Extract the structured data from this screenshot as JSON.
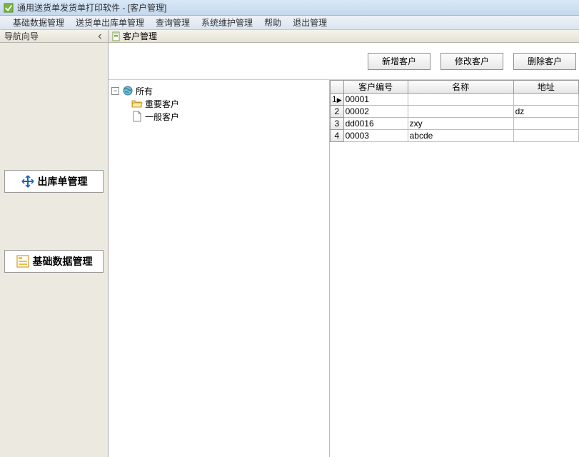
{
  "window": {
    "title": "通用送货单发货单打印软件  - [客户管理]"
  },
  "menubar": {
    "items": [
      "基础数据管理",
      "送货单出库单管理",
      "查询管理",
      "系统维护管理",
      "帮助",
      "退出管理"
    ]
  },
  "nav": {
    "header": "导航向导",
    "buttons": {
      "outbound": "出库单管理",
      "basedata": "基础数据管理"
    }
  },
  "content": {
    "tab_title": "客户管理"
  },
  "toolbar": {
    "add": "新增客户",
    "edit": "修改客户",
    "delete": "删除客户"
  },
  "tree": {
    "root": "所有",
    "children": [
      {
        "label": "重要客户",
        "icon": "folder"
      },
      {
        "label": "一般客户",
        "icon": "doc"
      }
    ]
  },
  "grid": {
    "headers": {
      "code": "客户编号",
      "name": "名称",
      "address": "地址"
    },
    "rows": [
      {
        "n": "1",
        "code": "00001",
        "name": "",
        "address": ""
      },
      {
        "n": "2",
        "code": "00002",
        "name": "",
        "address": "dz"
      },
      {
        "n": "3",
        "code": "dd0016",
        "name": "zxy",
        "address": ""
      },
      {
        "n": "4",
        "code": "00003",
        "name": "abcde",
        "address": ""
      }
    ]
  }
}
